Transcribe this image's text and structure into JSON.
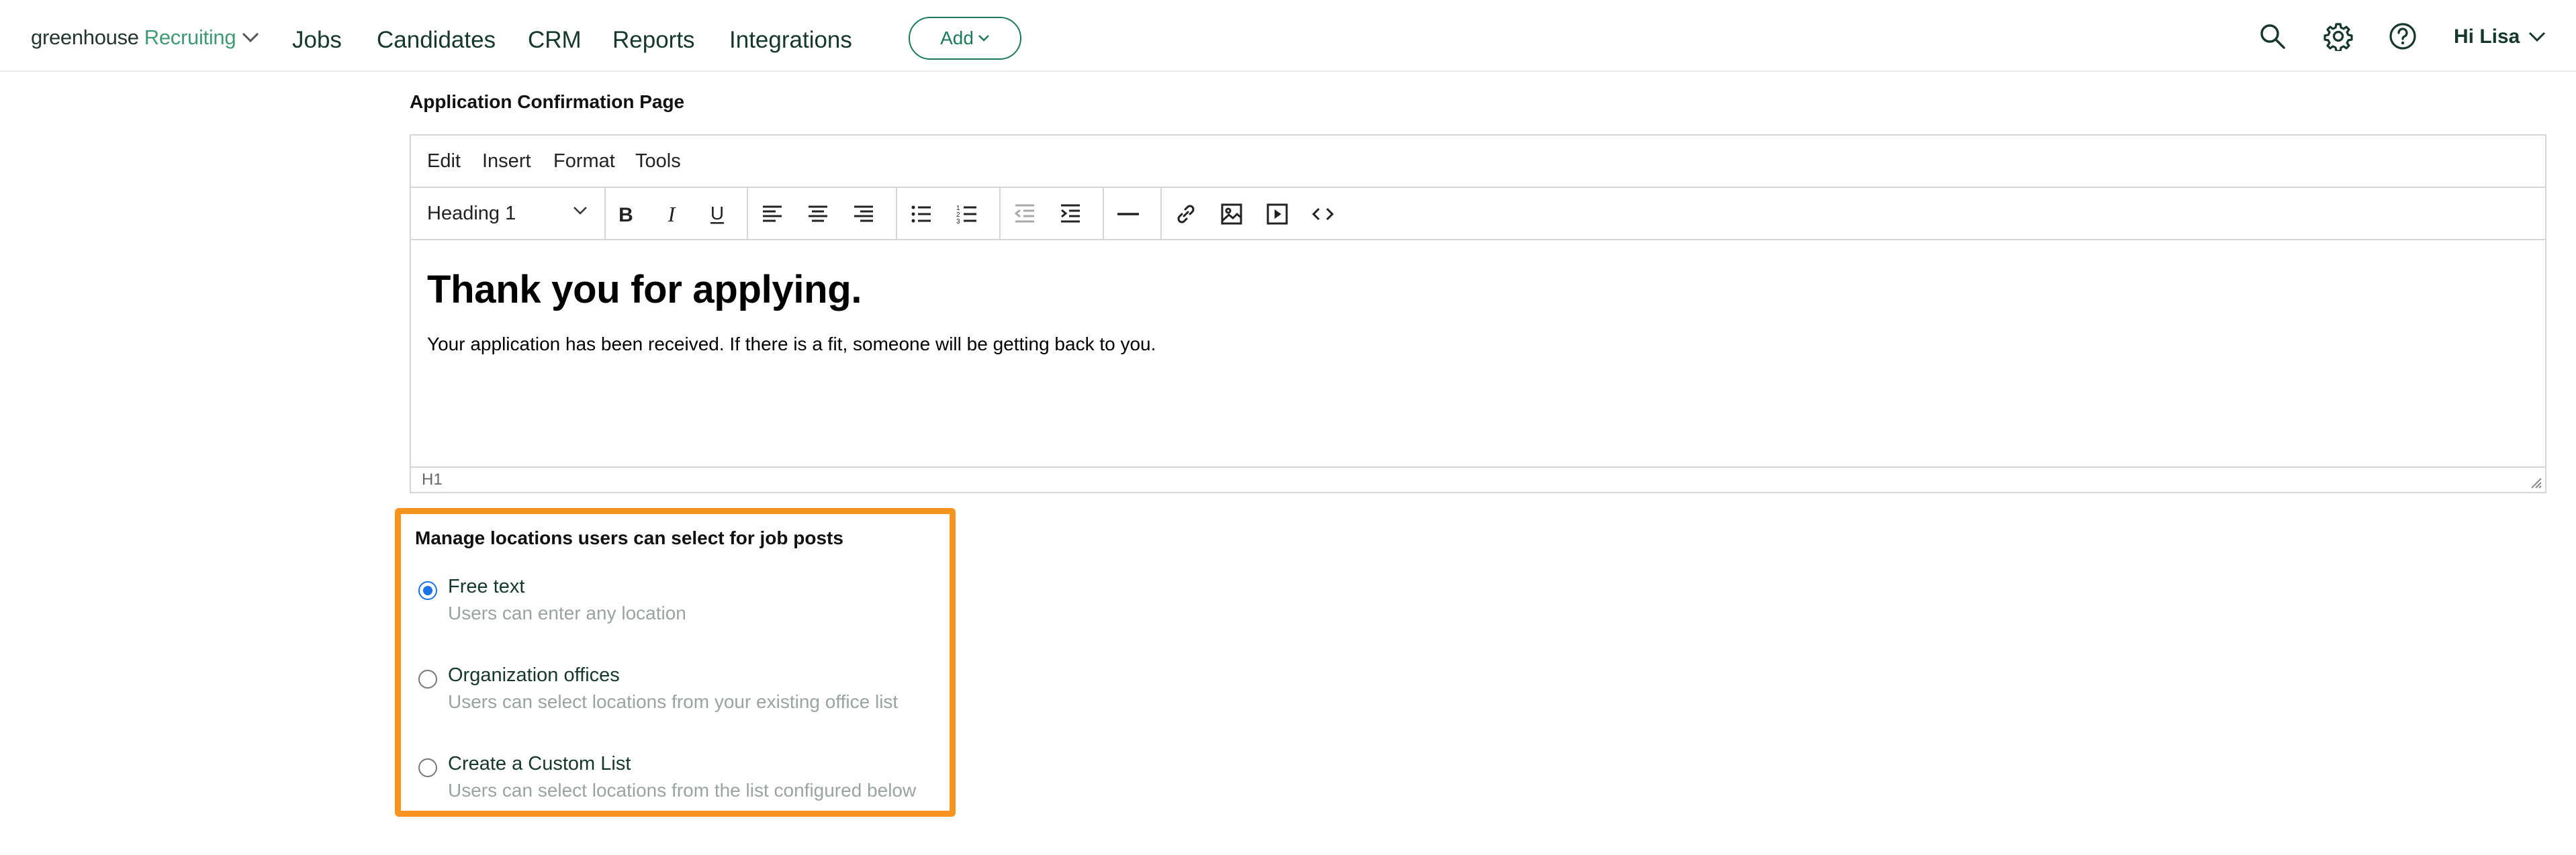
{
  "nav": {
    "brand_prefix": "greenhouse",
    "brand_suffix": "Recruiting",
    "links": [
      "Jobs",
      "Candidates",
      "CRM",
      "Reports",
      "Integrations"
    ],
    "add_label": "Add",
    "greeting": "Hi Lisa",
    "icons": [
      "search-icon",
      "gear-icon",
      "help-icon"
    ]
  },
  "editor": {
    "section_title": "Application Confirmation Page",
    "menu": [
      "Edit",
      "Insert",
      "Format",
      "Tools"
    ],
    "block_format": "Heading 1",
    "toolbar_icons": [
      "bold-icon",
      "italic-icon",
      "underline-icon",
      "align-left-icon",
      "align-center-icon",
      "align-right-icon",
      "bullet-list-icon",
      "numbered-list-icon",
      "outdent-icon",
      "indent-icon",
      "horizontal-rule-icon",
      "link-icon",
      "image-icon",
      "media-icon",
      "code-icon"
    ],
    "heading": "Thank you for applying.",
    "body": "Your application has been received. If there is a fit, someone will be getting back to you.",
    "status_path": "H1"
  },
  "locations": {
    "title": "Manage locations users can select for job posts",
    "selected": "Free text",
    "options": [
      {
        "label": "Free text",
        "description": "Users can enter any location"
      },
      {
        "label": "Organization offices",
        "description": "Users can select locations from your existing office list"
      },
      {
        "label": "Create a Custom List",
        "description": "Users can select locations from the list configured below"
      }
    ]
  },
  "colors": {
    "brand_green": "#3f9a76",
    "add_button": "#1a7a5a",
    "highlight_border": "#f7941d",
    "radio_selected": "#1a73e8"
  }
}
